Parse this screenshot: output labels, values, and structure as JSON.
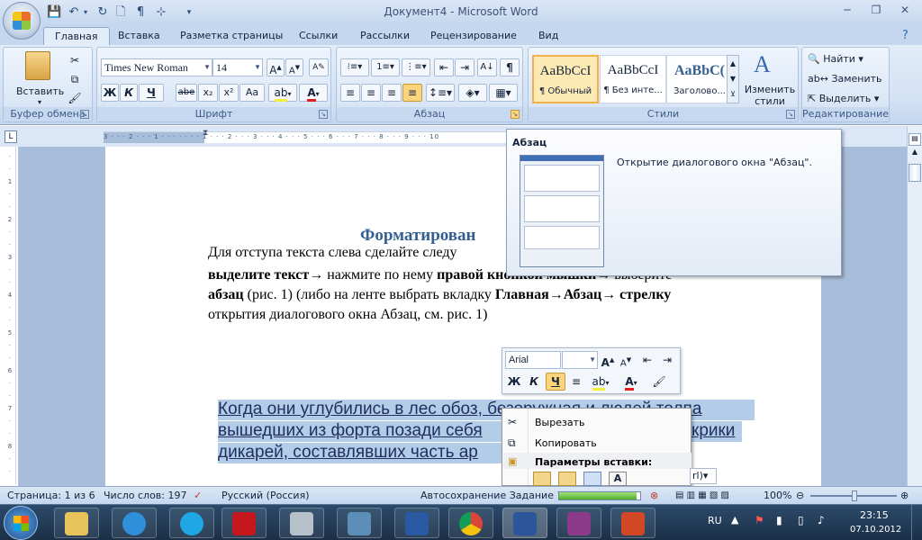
{
  "window": {
    "title": "Документ4 - Microsoft Word"
  },
  "tabs": [
    "Главная",
    "Вставка",
    "Разметка страницы",
    "Ссылки",
    "Рассылки",
    "Рецензирование",
    "Вид"
  ],
  "ribbon": {
    "clipboard": {
      "label": "Буфер обмена",
      "paste": "Вставить"
    },
    "font": {
      "label": "Шрифт",
      "name": "Times New Roman",
      "size": "14",
      "bold": "Ж",
      "italic": "К",
      "underline": "Ч",
      "strike": "abe",
      "sub": "x₂",
      "sup": "x²",
      "case": "Aa"
    },
    "paragraph": {
      "label": "Абзац"
    },
    "styles": {
      "label": "Стили",
      "items": [
        {
          "sample": "AaBbCcI",
          "name": "¶ Обычный"
        },
        {
          "sample": "AaBbCcI",
          "name": "¶ Без инте..."
        },
        {
          "sample": "AaBbC(",
          "name": "Заголово..."
        }
      ],
      "change": "Изменить стили"
    },
    "editing": {
      "label": "Редактирование",
      "find": "Найти",
      "replace": "Заменить",
      "select": "Выделить"
    }
  },
  "tooltip": {
    "title": "Абзац",
    "description": "Открытие диалогового окна \"Абзац\"."
  },
  "document": {
    "heading": "Форматирован",
    "line1": "Для отступа текста слева сделайте следу",
    "line2_bold": "выделите текст",
    "line2_rest": "→ нажмите по нему ",
    "line2_bold2": "правой кнопкой мышки",
    "line2_end": "→ выберите",
    "line3_bold": "абзац",
    "line3_mid": " (рис. 1) (либо на ленте выбрать вкладку ",
    "line3_bold2": "Главная→Абзац→ стрелку",
    "line4": "открытия диалогового окна Абзац, см. рис. 1)",
    "selected_lines": [
      "Когда они углубились в лес обоз, безоружная и людей толпа",
      "вышедших из форта позади себя",
      "крики",
      "дикарей, составлявших часть ар"
    ]
  },
  "minitoolbar": {
    "font": "Arial"
  },
  "context_menu": {
    "items": [
      "Вырезать",
      "Копировать"
    ],
    "section": "Параметры вставки:",
    "ctrl": "rl)"
  },
  "statusbar": {
    "page": "Страница: 1 из 6",
    "words": "Число слов: 197",
    "language": "Русский (Россия)",
    "autosave": "Автосохранение Задание 1:",
    "autosave_progress": 0.95,
    "zoom": "100%"
  },
  "taskbar": {
    "lang": "RU",
    "time": "23:15",
    "date": "07.10.2012"
  }
}
